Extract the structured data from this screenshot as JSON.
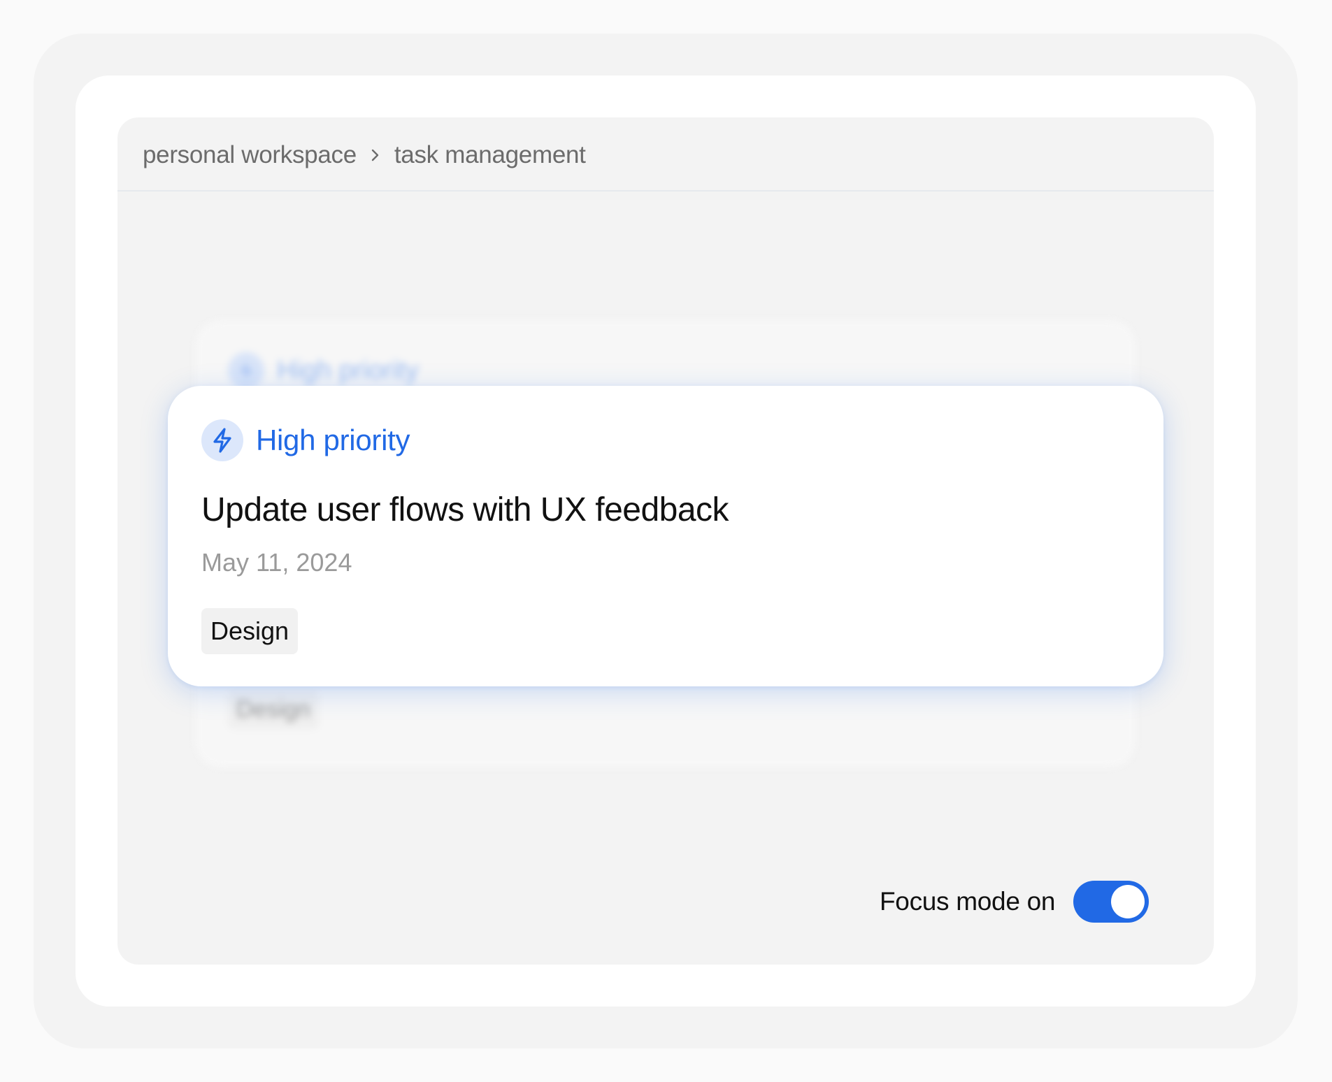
{
  "breadcrumb": {
    "items": [
      "personal workspace",
      "task management"
    ]
  },
  "background_card": {
    "priority_label": "High priority",
    "tag": "Design"
  },
  "task_card": {
    "priority_label": "High priority",
    "priority_icon": "lightning-bolt-icon",
    "title": "Update user flows with UX feedback",
    "date": "May 11, 2024",
    "tag": "Design"
  },
  "focus_mode": {
    "label": "Focus mode on",
    "enabled": true
  },
  "colors": {
    "accent": "#2169e5",
    "accent_soft": "#dce7fb",
    "panel_bg": "#f3f3f3",
    "text_primary": "#111111",
    "text_muted": "#9a9a9a"
  }
}
